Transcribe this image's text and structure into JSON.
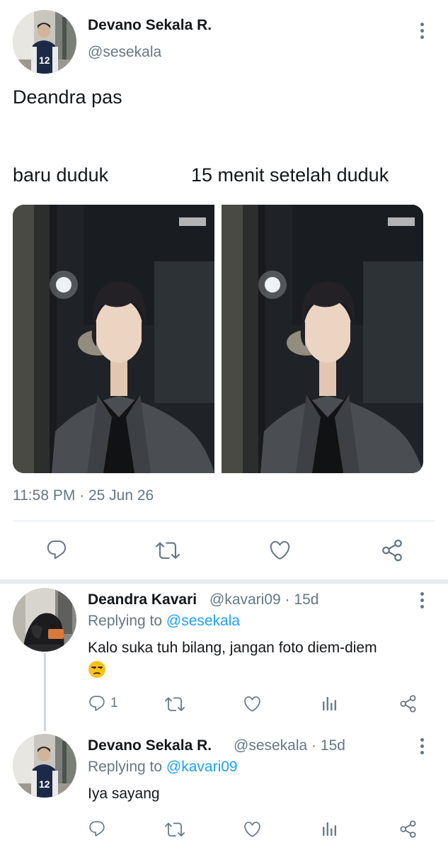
{
  "main_tweet": {
    "author_name": "Devano Sekala R.",
    "author_handle": "@sesekala",
    "text_line1": "Deandra pas",
    "caption_left": "baru duduk",
    "caption_right": "15 menit setelah duduk",
    "timestamp": "11:58 PM · 25 Jun 26",
    "actions": [
      "reply-icon",
      "retweet-icon",
      "like-icon",
      "share-icon"
    ]
  },
  "replies": [
    {
      "author_name": "Deandra Kavari",
      "author_handle": "@kavari09",
      "age_separator": "·",
      "age": "15d",
      "replying_prefix": "Replying to",
      "replying_to": "@sesekala",
      "text": "Kalo suka tuh bilang, jangan foto diem-diem",
      "emoji": "unamused-face",
      "reply_count": "1"
    },
    {
      "author_name": "Devano Sekala R.",
      "author_handle": "@sesekala",
      "age_separator": "·",
      "age": "15d",
      "replying_prefix": "Replying to",
      "replying_to": "@kavari09",
      "text": "Iya sayang"
    }
  ],
  "colors": {
    "text": "#14171a",
    "secondary": "#657786",
    "link": "#1da1f2",
    "divider": "#e1e8ed"
  }
}
